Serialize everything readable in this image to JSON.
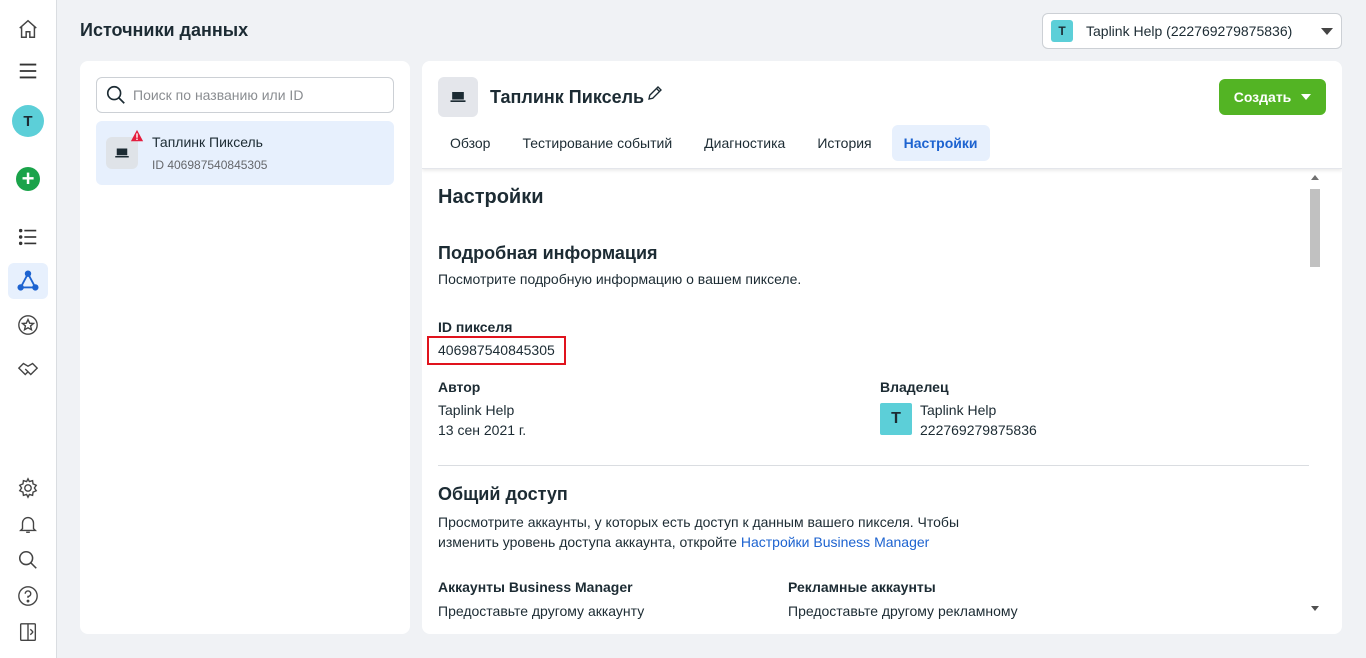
{
  "header": {
    "title": "Источники данных",
    "account_selector": {
      "avatar_letter": "T",
      "label": "Taplink Help (222769279875836)"
    }
  },
  "rail": {
    "avatar_letter": "T",
    "items": [
      "home-icon",
      "menu-icon",
      "avatar",
      "add-icon",
      "list-icon",
      "events-manager-icon",
      "star-icon",
      "handshake-icon",
      "settings-icon",
      "bell-icon",
      "search-icon",
      "help-icon",
      "panel-icon"
    ]
  },
  "left_panel": {
    "search_placeholder": "Поиск по названию или ID",
    "sources": [
      {
        "name": "Таплинк Пиксель",
        "id_line": "ID 406987540845305",
        "warning": true
      }
    ]
  },
  "pixel": {
    "title": "Таплинк Пиксель",
    "create_button": "Создать",
    "tabs": [
      "Обзор",
      "Тестирование событий",
      "Диагностика",
      "История",
      "Настройки"
    ],
    "active_tab": "Настройки"
  },
  "settings": {
    "heading": "Настройки",
    "details": {
      "heading": "Подробная информация",
      "description": "Посмотрите подробную информацию о вашем пикселе.",
      "pixel_id_label": "ID пикселя",
      "pixel_id": "406987540845305",
      "author_label": "Автор",
      "author_name": "Taplink Help",
      "author_date": "13 сен 2021 г.",
      "owner_label": "Владелец",
      "owner_letter": "T",
      "owner_name": "Taplink Help",
      "owner_id": "222769279875836"
    },
    "access": {
      "heading": "Общий доступ",
      "description_line1": "Просмотрите аккаунты, у которых есть доступ к данным вашего пикселя. Чтобы",
      "description_line2": "изменить уровень доступа аккаунта, откройте ",
      "link": "Настройки Business Manager",
      "bm_label": "Аккаунты Business Manager",
      "bm_text": "Предоставьте другому аккаунту",
      "ad_label": "Рекламные аккаунты",
      "ad_text": "Предоставьте другому рекламному"
    }
  },
  "colors": {
    "accent": "#1d63d0",
    "create": "#53b424",
    "highlight": "#e0131d"
  }
}
